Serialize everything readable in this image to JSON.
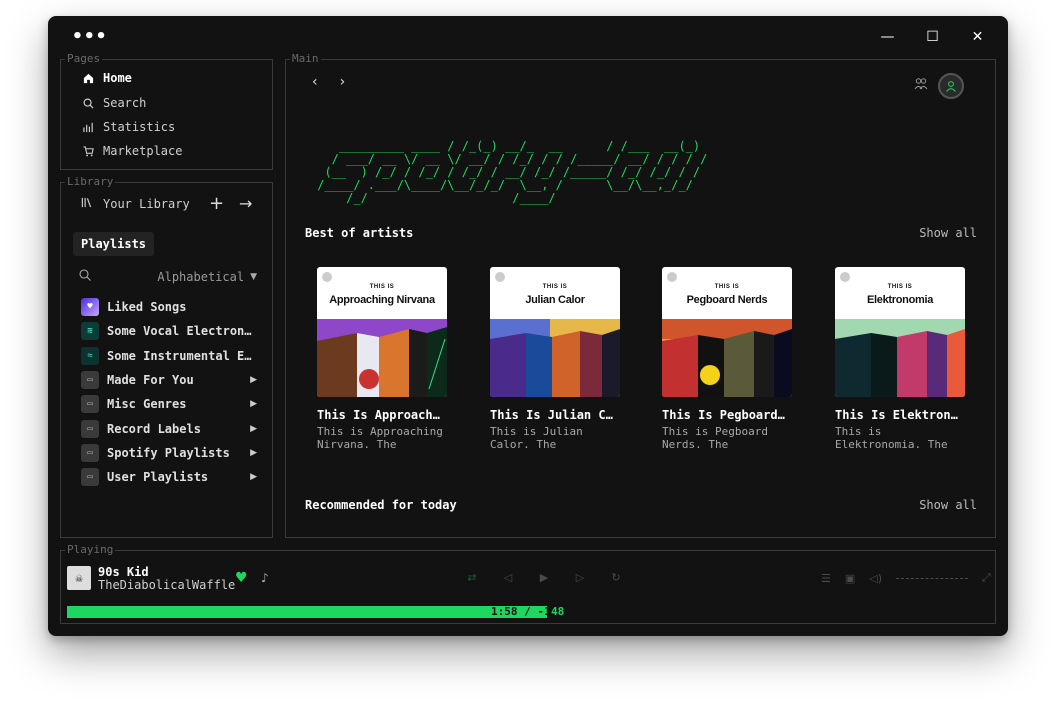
{
  "window": {
    "menu_dots": "•••",
    "controls": {
      "minimize": "—",
      "maximize": "☐",
      "close": "✕"
    }
  },
  "pages": {
    "legend": "Pages",
    "items": [
      {
        "label": "Home",
        "icon": "home-icon",
        "active": true
      },
      {
        "label": "Search",
        "icon": "search-icon"
      },
      {
        "label": "Statistics",
        "icon": "chart-icon"
      },
      {
        "label": "Marketplace",
        "icon": "cart-icon"
      }
    ]
  },
  "library": {
    "legend": "Library",
    "title": "Your Library",
    "filter_chip": "Playlists",
    "sort": "Alphabetical",
    "items": [
      {
        "label": "Liked Songs",
        "type": "liked"
      },
      {
        "label": "Some Vocal Electronic",
        "type": "playlist"
      },
      {
        "label": "Some Instrumental Electronic",
        "type": "playlist"
      },
      {
        "label": "Made For You",
        "type": "folder"
      },
      {
        "label": "Misc Genres",
        "type": "folder"
      },
      {
        "label": "Record Labels",
        "type": "folder"
      },
      {
        "label": "Spotify Playlists",
        "type": "folder"
      },
      {
        "label": "User Playlists",
        "type": "folder"
      }
    ]
  },
  "main": {
    "legend": "Main",
    "ascii_logo": "    _________ ____ / /_(_) __/_  __      / /___  __(_)\n   / ___/ __ \\/ __ \\/ __/ / /_/ / / /_____/ __/ / / / /\n  (__  ) /_/ / /_/ / /_/ / __/ /_/ /_____/ /_/ /_/ / /\n /____/ .___/\\____/\\__/_/_/  \\__, /      \\__/\\__,_/_/\n     /_/                    /____/",
    "section1": {
      "title": "Best of artists",
      "show_all": "Show all"
    },
    "section2": {
      "title": "Recommended for today",
      "show_all": "Show all"
    },
    "cards": [
      {
        "cover_label": "THIS IS",
        "cover_artist": "Approaching Nirvana",
        "title": "This Is Approaching Nirvana",
        "desc": "This is Approaching Nirvana. The essential tracks, all in one playlist."
      },
      {
        "cover_label": "THIS IS",
        "cover_artist": "Julian Calor",
        "title": "This Is Julian Calor",
        "desc": "This is Julian Calor. The essential tracks, all in one playlist."
      },
      {
        "cover_label": "THIS IS",
        "cover_artist": "Pegboard Nerds",
        "title": "This Is Pegboard Nerds",
        "desc": "This is Pegboard Nerds. The essential tracks, all in one playlist."
      },
      {
        "cover_label": "THIS IS",
        "cover_artist": "Elektronomia",
        "title": "This Is Elektronomia",
        "desc": "This is Elektronomia. The essential tracks, all in one playlist."
      }
    ]
  },
  "playing": {
    "legend": "Playing",
    "title": "90s Kid",
    "artist": "TheDiabolicalWaffle",
    "time_main": "1:58 / -1:",
    "time_tail": "48",
    "progress": 0.52
  },
  "colors": {
    "accent": "#1ed760",
    "background": "#121212",
    "border": "#3a3a3a"
  }
}
